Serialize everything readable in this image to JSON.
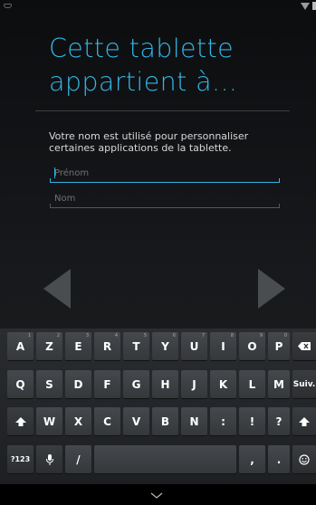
{
  "title": "Cette tablette\nappartient à...",
  "description": "Votre nom est utilisé pour personnaliser\ncertaines applications de la tablette.",
  "first_name": {
    "placeholder": "Prénom",
    "value": ""
  },
  "last_name": {
    "placeholder": "Nom",
    "value": ""
  },
  "keyboard": {
    "row1": [
      {
        "label": "A",
        "hint": "1"
      },
      {
        "label": "Z",
        "hint": "2"
      },
      {
        "label": "E",
        "hint": "3"
      },
      {
        "label": "R",
        "hint": "4"
      },
      {
        "label": "T",
        "hint": "5"
      },
      {
        "label": "Y",
        "hint": "6"
      },
      {
        "label": "U",
        "hint": "7"
      },
      {
        "label": "I",
        "hint": "8"
      },
      {
        "label": "O",
        "hint": "9"
      },
      {
        "label": "P",
        "hint": "0"
      }
    ],
    "row2": [
      "Q",
      "S",
      "D",
      "F",
      "G",
      "H",
      "J",
      "K",
      "L",
      "M"
    ],
    "enter_label": "Suiv.",
    "row3": [
      "W",
      "X",
      "C",
      "V",
      "B",
      "N",
      ":",
      "!",
      "?"
    ],
    "symbols_label": "?123",
    "comma": ",",
    "period": "."
  },
  "icons": {
    "backspace": "backspace-icon",
    "shift": "shift-icon",
    "mic": "microphone-icon",
    "emoji": "emoji-icon",
    "hide_keyboard": "chevron-down-icon",
    "prev": "arrow-left-icon",
    "next": "arrow-right-icon"
  },
  "colors": {
    "accent": "#33b5e5"
  }
}
